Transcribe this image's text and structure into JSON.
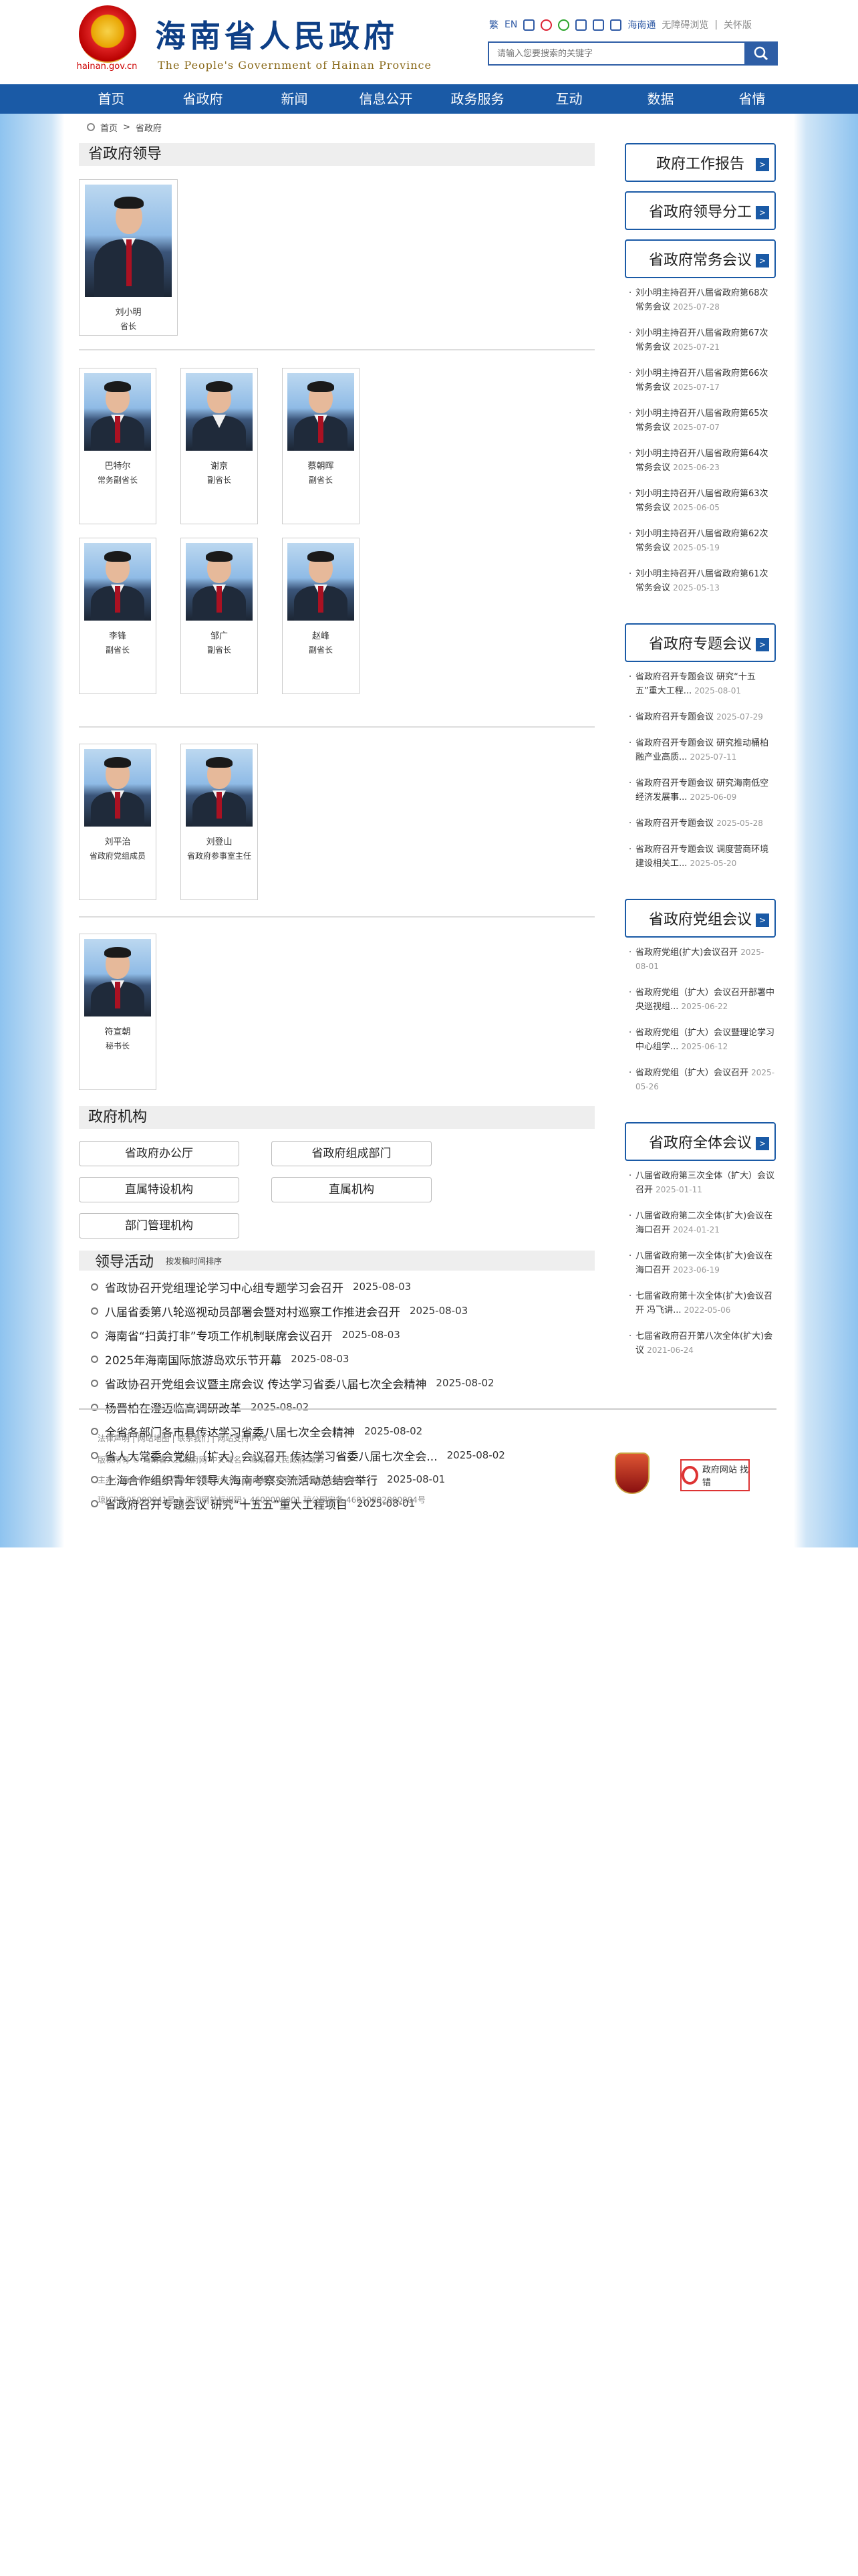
{
  "header": {
    "logo_url_text": "hainan.gov.cn",
    "site_name_cn": "海南省人民政府",
    "site_name_en": "The People's Government of Hainan Province",
    "lang_cn": "繁",
    "lang_en": "EN",
    "wechat_robot": "海南通",
    "accessible": "无障碍浏览",
    "care": "关怀版",
    "search_placeholder": "请输入您要搜索的关键字"
  },
  "nav": [
    "首页",
    "省政府",
    "新闻",
    "信息公开",
    "政务服务",
    "互动",
    "数据",
    "省情"
  ],
  "breadcrumb": {
    "home": "首页",
    "sep": ">",
    "current": "省政府"
  },
  "leaders": {
    "title": "省政府领导",
    "governor": {
      "name": "刘小明",
      "post": "省长"
    },
    "vice_row1": [
      {
        "name": "巴特尔",
        "post": "常务副省长"
      },
      {
        "name": "谢京",
        "post": "副省长"
      },
      {
        "name": "蔡朝晖",
        "post": "副省长"
      }
    ],
    "vice_row2": [
      {
        "name": "李锋",
        "post": "副省长"
      },
      {
        "name": "邹广",
        "post": "副省长"
      },
      {
        "name": "赵峰",
        "post": "副省长"
      }
    ],
    "others": [
      {
        "name": "刘平治",
        "post": "省政府党组成员"
      },
      {
        "name": "刘登山",
        "post": "省政府参事室主任"
      }
    ],
    "secretary": {
      "name": "符宣朝",
      "post": "秘书长"
    }
  },
  "orgs": {
    "title": "政府机构",
    "items": [
      "省政府办公厅",
      "省政府组成部门",
      "直属特设机构",
      "直属机构",
      "部门管理机构"
    ]
  },
  "activities": {
    "title": "领导活动",
    "subtitle": "按发稿时间排序",
    "items": [
      {
        "text": "省政协召开党组理论学习中心组专题学习会召开",
        "date": "2025-08-03"
      },
      {
        "text": "八届省委第八轮巡视动员部署会暨对村巡察工作推进会召开",
        "date": "2025-08-03"
      },
      {
        "text": "海南省“扫黄打非”专项工作机制联席会议召开",
        "date": "2025-08-03"
      },
      {
        "text": "2025年海南国际旅游岛欢乐节开幕",
        "date": "2025-08-03"
      },
      {
        "text": "省政协召开党组会议暨主席会议 传达学习省委八届七次全会精神",
        "date": "2025-08-02"
      },
      {
        "text": "杨晋柏在澄迈临高调研改革",
        "date": "2025-08-02"
      },
      {
        "text": "全省各部门各市县传达学习省委八届七次全会精神",
        "date": "2025-08-02"
      },
      {
        "text": "省人大常委会党组（扩大）会议召开 传达学习省委八届七次全会...",
        "date": "2025-08-02"
      },
      {
        "text": "上海合作组织青年领导人海南考察交流活动总结会举行",
        "date": "2025-08-01"
      },
      {
        "text": "省政府召开专题会议 研究“十五五”重大工程项目",
        "date": "2025-08-01"
      }
    ]
  },
  "sidebar": {
    "report": "政府工作报告",
    "division": "省政府领导分工",
    "standing": {
      "title": "省政府常务会议",
      "items": [
        {
          "text": "刘小明主持召开八届省政府第68次常务会议",
          "date": "2025-07-28"
        },
        {
          "text": "刘小明主持召开八届省政府第67次常务会议",
          "date": "2025-07-21"
        },
        {
          "text": "刘小明主持召开八届省政府第66次常务会议",
          "date": "2025-07-17"
        },
        {
          "text": "刘小明主持召开八届省政府第65次常务会议",
          "date": "2025-07-07"
        },
        {
          "text": "刘小明主持召开八届省政府第64次常务会议",
          "date": "2025-06-23"
        },
        {
          "text": "刘小明主持召开八届省政府第63次常务会议",
          "date": "2025-06-05"
        },
        {
          "text": "刘小明主持召开八届省政府第62次常务会议",
          "date": "2025-05-19"
        },
        {
          "text": "刘小明主持召开八届省政府第61次常务会议",
          "date": "2025-05-13"
        }
      ]
    },
    "special": {
      "title": "省政府专题会议",
      "items": [
        {
          "text": "省政府召开专题会议 研究“十五五”重大工程...",
          "date": "2025-08-01"
        },
        {
          "text": "省政府召开专题会议",
          "date": "2025-07-29"
        },
        {
          "text": "省政府召开专题会议 研究推动桶柏融产业高质...",
          "date": "2025-07-11"
        },
        {
          "text": "省政府召开专题会议 研究海南低空经济发展事...",
          "date": "2025-06-09"
        },
        {
          "text": "省政府召开专题会议",
          "date": "2025-05-28"
        },
        {
          "text": "省政府召开专题会议 调度营商环境建设相关工...",
          "date": "2025-05-20"
        }
      ]
    },
    "party": {
      "title": "省政府党组会议",
      "items": [
        {
          "text": "省政府党组(扩大)会议召开",
          "date": "2025-08-01"
        },
        {
          "text": "省政府党组（扩大）会议召开部署中央巡视组...",
          "date": "2025-06-22"
        },
        {
          "text": "省政府党组（扩大）会议暨理论学习中心组学...",
          "date": "2025-06-12"
        },
        {
          "text": "省政府党组（扩大）会议召开",
          "date": "2025-05-26"
        }
      ]
    },
    "plenary": {
      "title": "省政府全体会议",
      "items": [
        {
          "text": "八届省政府第三次全体（扩大）会议召开",
          "date": "2025-01-11"
        },
        {
          "text": "八届省政府第二次全体(扩大)会议在海口召开",
          "date": "2024-01-21"
        },
        {
          "text": "八届省政府第一次全体(扩大)会议在海口召开",
          "date": "2023-06-19"
        },
        {
          "text": "七届省政府第十次全体(扩大)会议召开 冯飞讲...",
          "date": "2022-05-06"
        },
        {
          "text": "七届省政府召开第八次全体(扩大)会议",
          "date": "2021-06-24"
        }
      ]
    }
  },
  "footer": {
    "line1": "法律声明 | 网站地图 | 联系我们 | 网站支持IPV6",
    "line2": "版权所有 © 海南省人民政府网   中文域名：海南省人民政府.政务",
    "line3": "主办：海南省人民政府办公厅    运行维护：海南省人民政府网站运行管理中心",
    "line4": "琼ICP备05000041号-1  政府网站标识码：4600000001  琼公网安备 46010802000004号",
    "badge_text": "政府网站 找错"
  }
}
